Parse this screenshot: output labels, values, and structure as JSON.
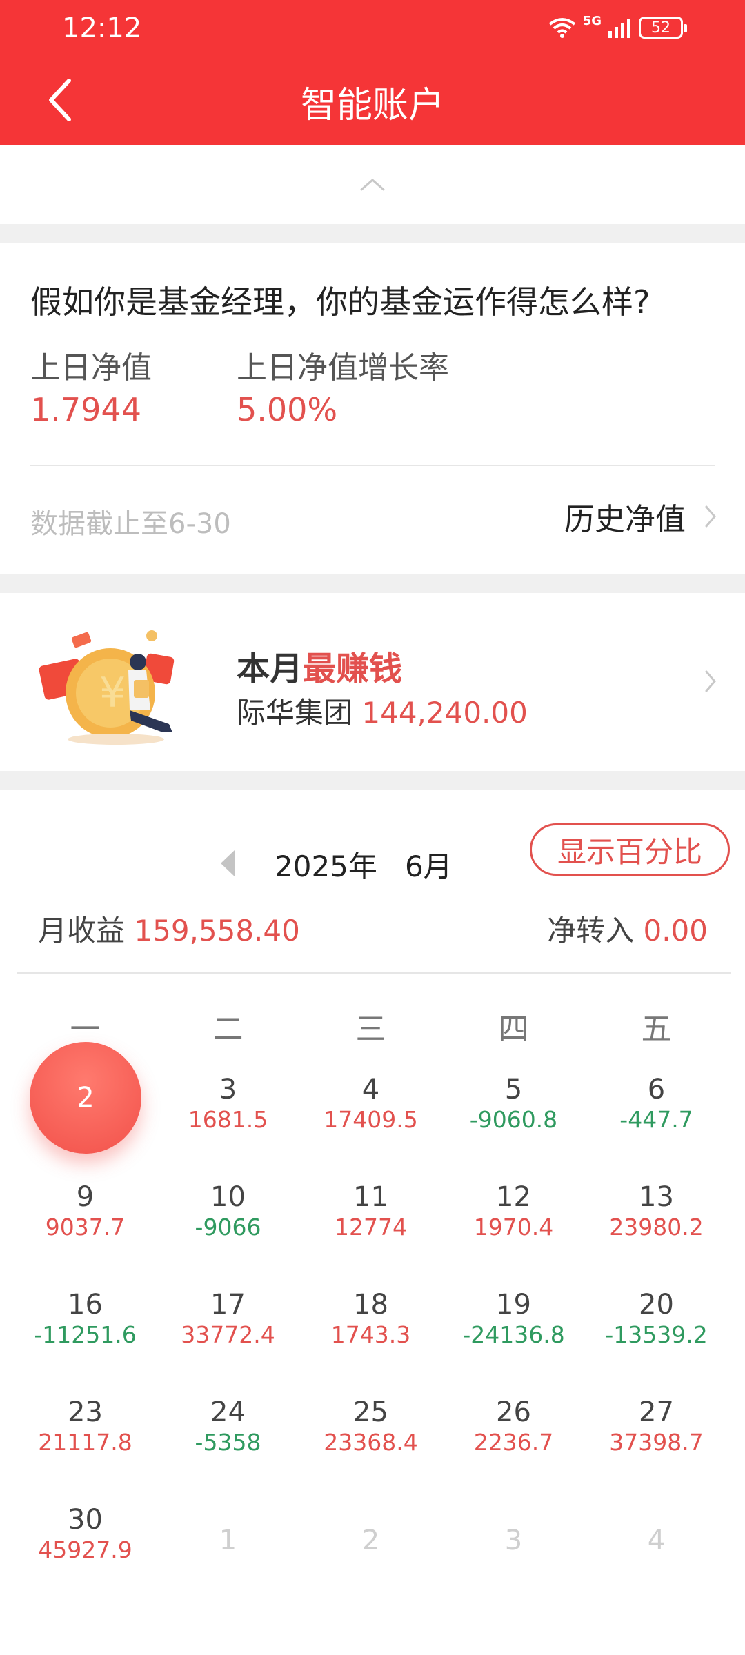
{
  "status_bar": {
    "time": "12:12",
    "network": "5G",
    "battery": "52"
  },
  "nav": {
    "title": "智能账户"
  },
  "fund": {
    "question": "假如你是基金经理，你的基金运作得怎么样?",
    "nav_label": "上日净值",
    "nav_value": "1.7944",
    "growth_label": "上日净值增长率",
    "growth_value": "5.00%",
    "data_date": "数据截止至6-30",
    "history_link": "历史净值"
  },
  "best_month": {
    "title_prefix": "本月",
    "title_highlight": "最赚钱",
    "company": "际华集团",
    "amount": "144,240.00"
  },
  "calendar": {
    "year": "2025年",
    "month": "6月",
    "pct_button": "显示百分比",
    "monthly_income_label": "月收益",
    "monthly_income_value": "159,558.40",
    "net_transfer_label": "净转入",
    "net_transfer_value": "0.00",
    "weekdays": [
      "一",
      "二",
      "三",
      "四",
      "五"
    ],
    "weeks": [
      [
        {
          "day": "2",
          "value": "",
          "selected": true
        },
        {
          "day": "3",
          "value": "1681.5",
          "tone": "red"
        },
        {
          "day": "4",
          "value": "17409.5",
          "tone": "red"
        },
        {
          "day": "5",
          "value": "-9060.8",
          "tone": "green"
        },
        {
          "day": "6",
          "value": "-447.7",
          "tone": "green"
        }
      ],
      [
        {
          "day": "9",
          "value": "9037.7",
          "tone": "red"
        },
        {
          "day": "10",
          "value": "-9066",
          "tone": "green"
        },
        {
          "day": "11",
          "value": "12774",
          "tone": "red"
        },
        {
          "day": "12",
          "value": "1970.4",
          "tone": "red"
        },
        {
          "day": "13",
          "value": "23980.2",
          "tone": "red"
        }
      ],
      [
        {
          "day": "16",
          "value": "-11251.6",
          "tone": "green"
        },
        {
          "day": "17",
          "value": "33772.4",
          "tone": "red"
        },
        {
          "day": "18",
          "value": "1743.3",
          "tone": "red"
        },
        {
          "day": "19",
          "value": "-24136.8",
          "tone": "green"
        },
        {
          "day": "20",
          "value": "-13539.2",
          "tone": "green"
        }
      ],
      [
        {
          "day": "23",
          "value": "21117.8",
          "tone": "red"
        },
        {
          "day": "24",
          "value": "-5358",
          "tone": "green"
        },
        {
          "day": "25",
          "value": "23368.4",
          "tone": "red"
        },
        {
          "day": "26",
          "value": "2236.7",
          "tone": "red"
        },
        {
          "day": "27",
          "value": "37398.7",
          "tone": "red"
        }
      ],
      [
        {
          "day": "30",
          "value": "45927.9",
          "tone": "red"
        },
        {
          "day": "1",
          "value": "",
          "faded": true
        },
        {
          "day": "2",
          "value": "",
          "faded": true
        },
        {
          "day": "3",
          "value": "",
          "faded": true
        },
        {
          "day": "4",
          "value": "",
          "faded": true
        }
      ]
    ]
  },
  "colors": {
    "brand_red": "#f53537",
    "gain": "#e2514e",
    "loss": "#2f9a5f"
  }
}
